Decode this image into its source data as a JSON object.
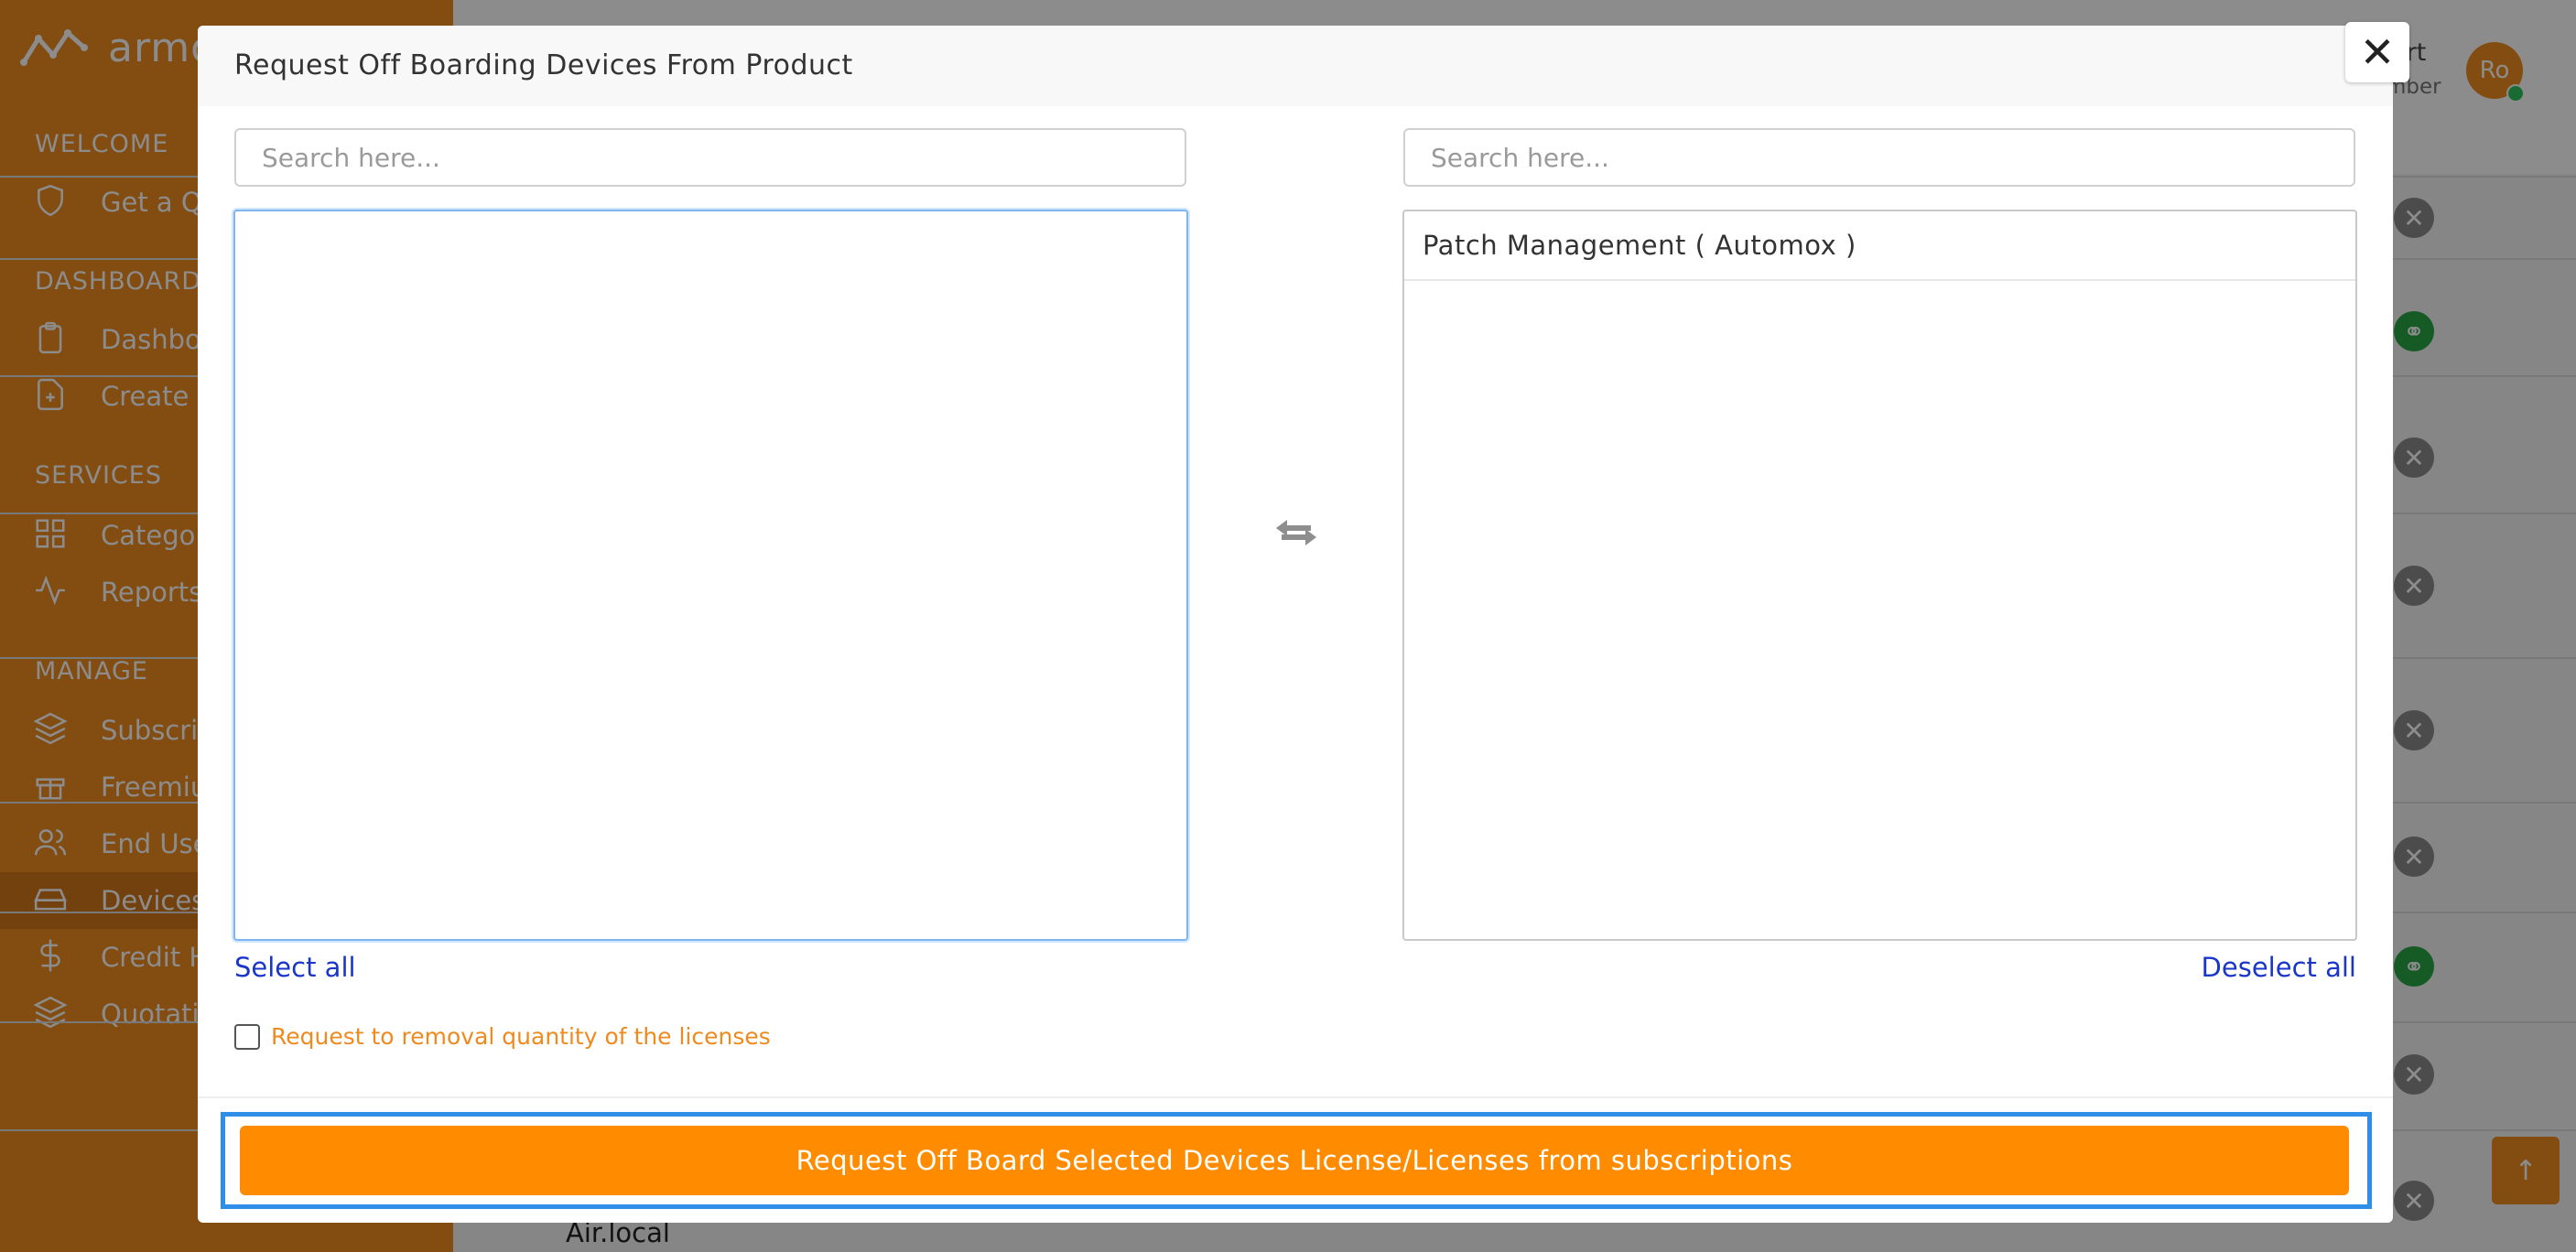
{
  "app": {
    "logo_text": "armo",
    "sections": {
      "welcome": "WELCOME",
      "dashboard": "DASHBOARD",
      "services": "SERVICES",
      "manage": "MANAGE"
    },
    "sidebar_items": [
      {
        "label": "Get a Qu",
        "icon": "shield-icon"
      },
      {
        "label": "Dashboa",
        "icon": "clipboard-icon"
      },
      {
        "label": "Create D",
        "icon": "file-plus-icon"
      },
      {
        "label": "Categor",
        "icon": "grid-icon"
      },
      {
        "label": "Reports",
        "icon": "activity-icon"
      },
      {
        "label": "Subscrip",
        "icon": "layers-icon"
      },
      {
        "label": "Freemiu",
        "icon": "gift-icon"
      },
      {
        "label": "End Use",
        "icon": "users-icon"
      },
      {
        "label": "Devices",
        "icon": "hard-drive-icon"
      },
      {
        "label": "Credit H",
        "icon": "dollar-icon"
      },
      {
        "label": "Quotatio",
        "icon": "layers-icon"
      }
    ],
    "user": {
      "name": "ert",
      "role": "mber",
      "initials": "Ro"
    },
    "bottom_cell": "Air.local",
    "scroll_top_icon": "arrow-up-icon"
  },
  "modal": {
    "title": "Request Off Boarding Devices From Product",
    "close_icon": "close-icon",
    "left_search_placeholder": "Search here...",
    "right_search_placeholder": "Search here...",
    "left_items": [],
    "right_items": [
      "Patch Management ( Automox )"
    ],
    "select_all": "Select all",
    "deselect_all": "Deselect all",
    "checkbox_label": "Request to removal quantity of the licenses",
    "submit_label": "Request Off Board Selected Devices License/Licenses from subscriptions"
  },
  "colors": {
    "brand_orange": "#ee8a1e",
    "submit_orange": "#ff8c00",
    "link_blue": "#1a36c9",
    "focus_blue": "#2f8fe8"
  }
}
